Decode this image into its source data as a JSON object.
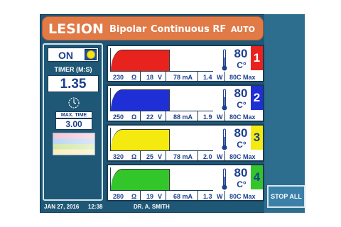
{
  "header": {
    "title": "LESION",
    "mode": "Bipolar",
    "rf_mode": "Continuous RF",
    "auto": "AUTO"
  },
  "status": {
    "power": "ON",
    "timer_label": "TIMER (M:S)",
    "timer_value": "1.35",
    "max_time_label": "MAX. TIME",
    "max_time_value": "3.00"
  },
  "channels": [
    {
      "id": "1",
      "color": "#e8231e",
      "num_bg": "#e8231e",
      "num_color": "#ffffff",
      "impedance": "230",
      "ohm": "Ω",
      "voltage": "18",
      "v_unit": "V",
      "current": "78 mA",
      "power": "1.4",
      "w_unit": "W",
      "temp": "80",
      "temp_unit": "C°",
      "max_label": "80C Max"
    },
    {
      "id": "2",
      "color": "#1f2fd6",
      "num_bg": "#1f2fd6",
      "num_color": "#ffffff",
      "impedance": "250",
      "ohm": "Ω",
      "voltage": "22",
      "v_unit": "V",
      "current": "88 mA",
      "power": "1.9",
      "w_unit": "W",
      "temp": "80",
      "temp_unit": "C°",
      "max_label": "80C Max"
    },
    {
      "id": "3",
      "color": "#f4ea10",
      "num_bg": "#f4ea10",
      "num_color": "#1c3f8f",
      "impedance": "320",
      "ohm": "Ω",
      "voltage": "25",
      "v_unit": "V",
      "current": "78 mA",
      "power": "2.0",
      "w_unit": "W",
      "temp": "80",
      "temp_unit": "C°",
      "max_label": "80C Max"
    },
    {
      "id": "4",
      "color": "#33c62a",
      "num_bg": "#33c62a",
      "num_color": "#1c3f8f",
      "impedance": "280",
      "ohm": "Ω",
      "voltage": "19",
      "v_unit": "V",
      "current": "68 mA",
      "power": "1.3",
      "w_unit": "W",
      "temp": "80",
      "temp_unit": "C°",
      "max_label": "80C Max"
    }
  ],
  "footer": {
    "date": "JAN 27, 2016",
    "time": "12:38",
    "doctor": "DR. A. SMITH"
  },
  "actions": {
    "stop_all": "STOP ALL"
  },
  "icons": {
    "indicator": "yellow-status-dot",
    "timer": "clock-icon",
    "thermometer": "thermometer-icon"
  }
}
